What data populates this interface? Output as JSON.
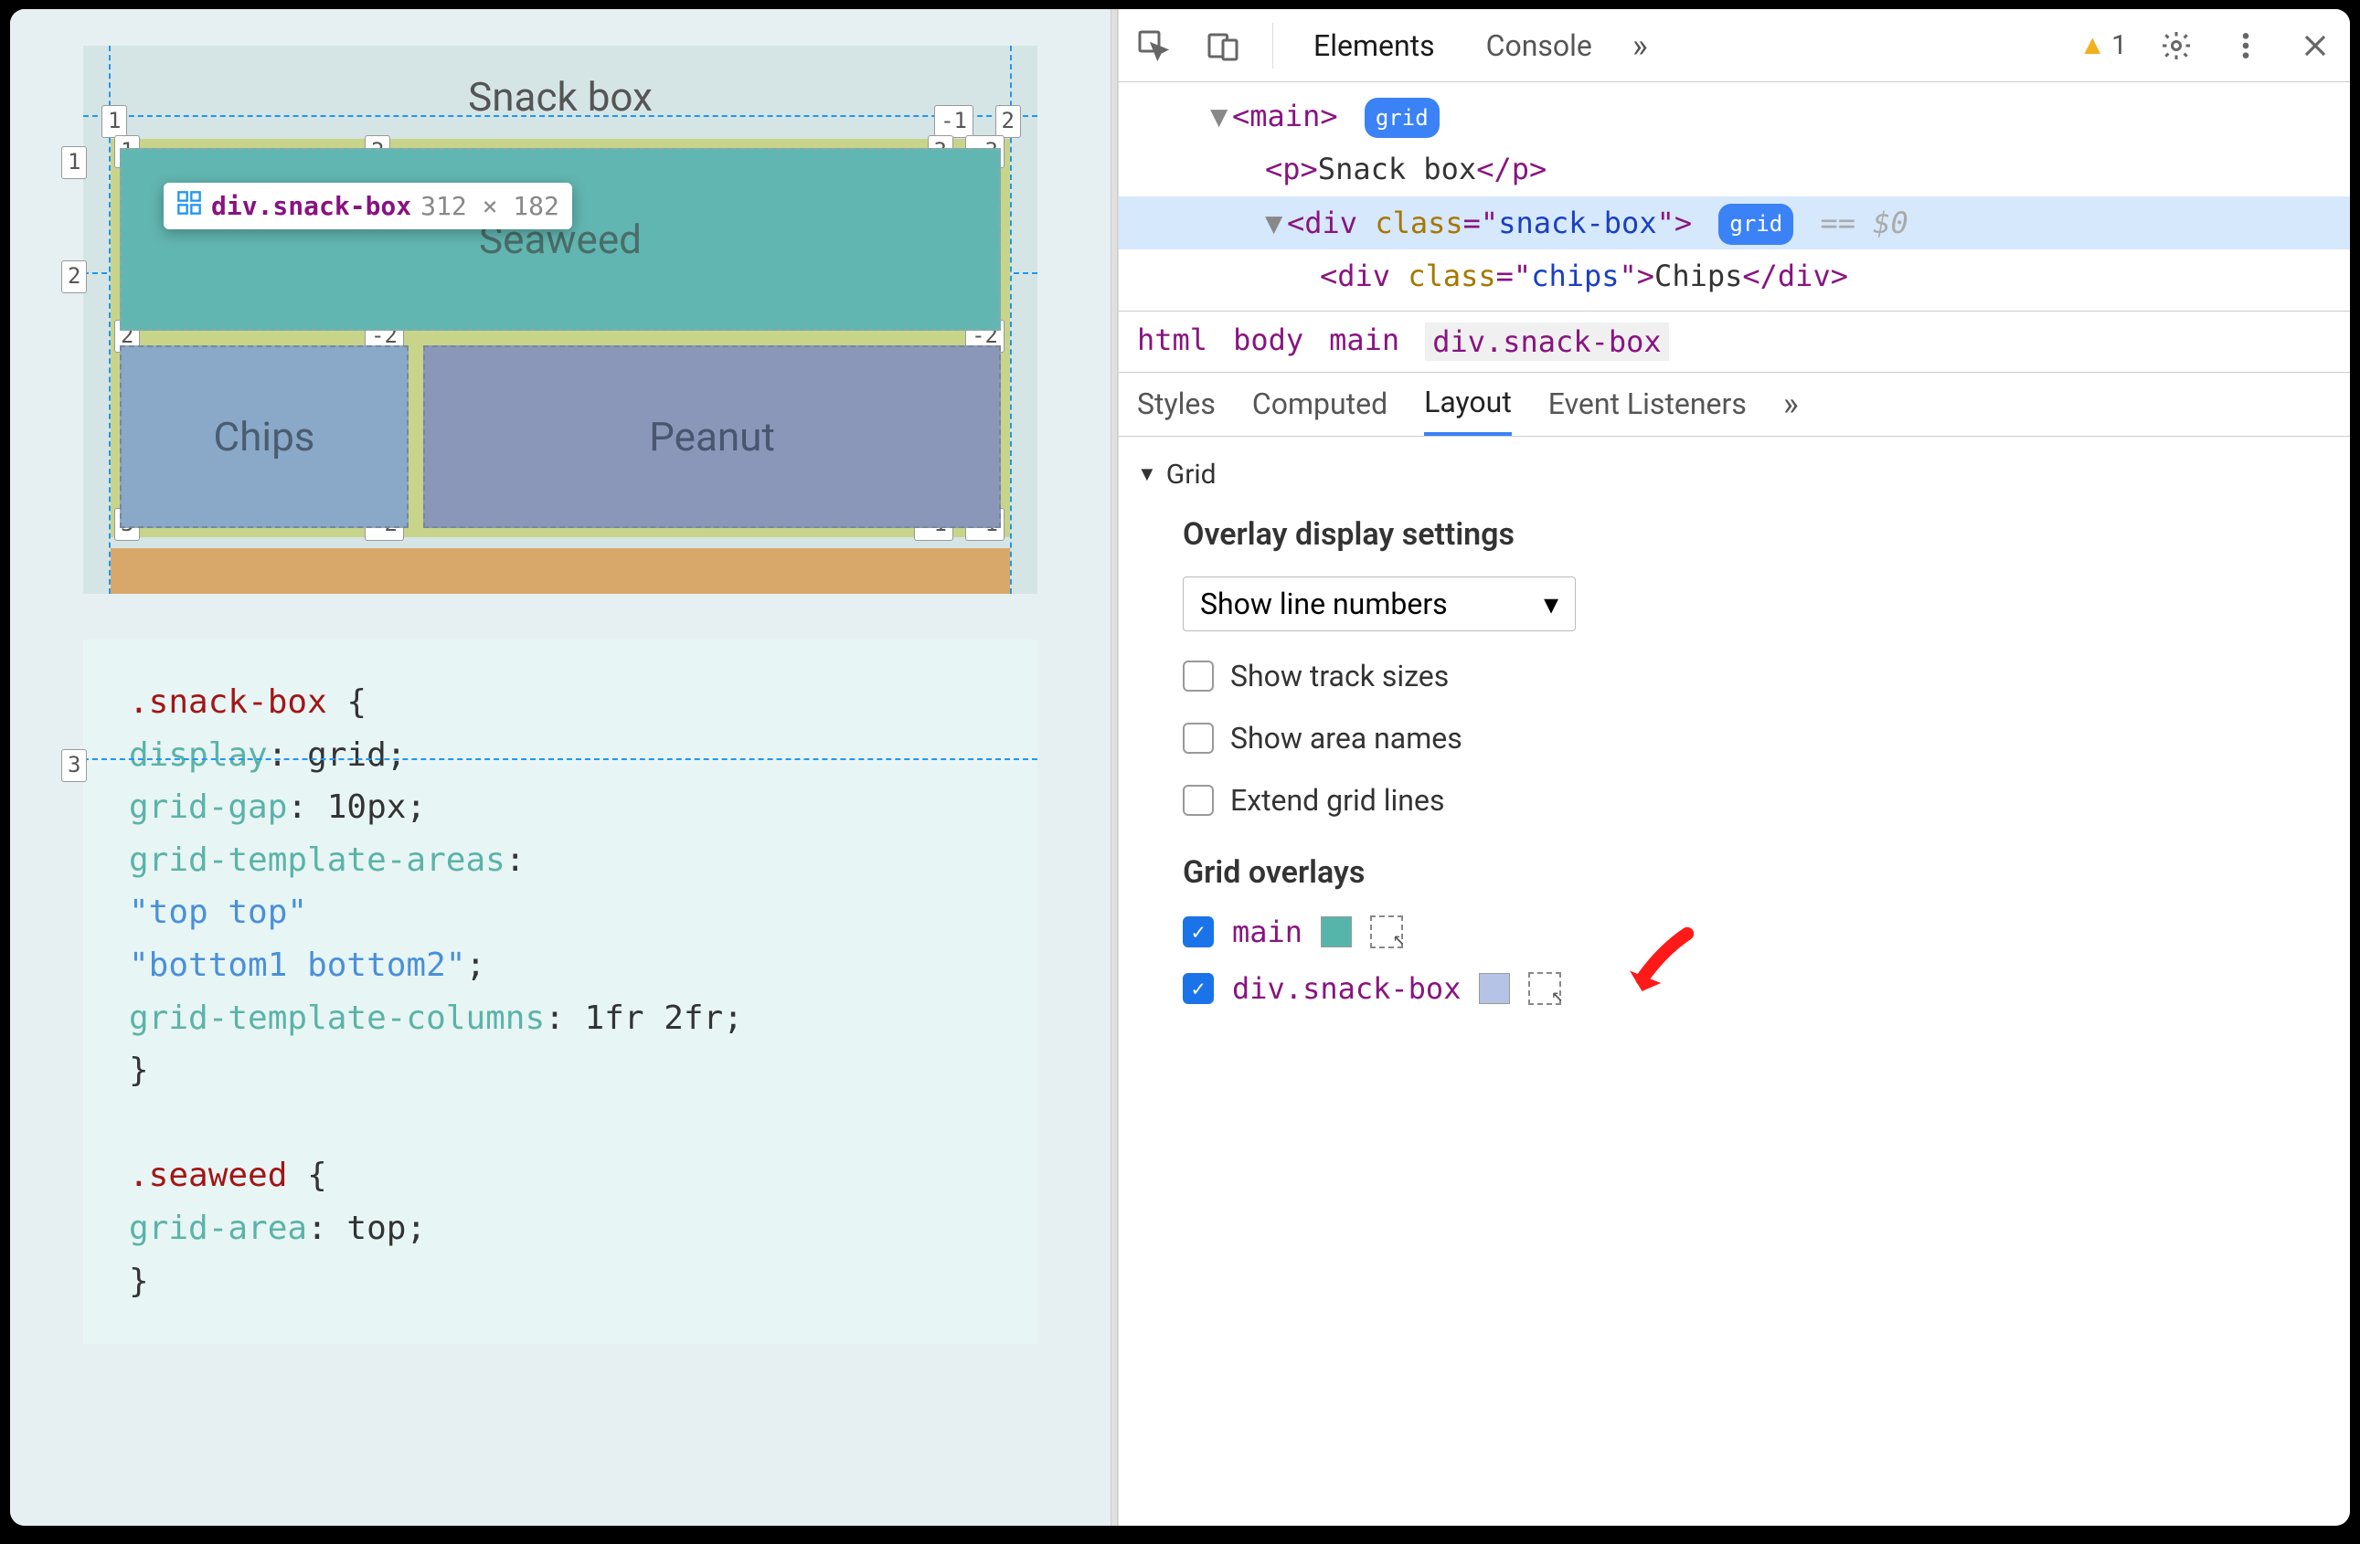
{
  "preview": {
    "heading": "Snack box",
    "cells": {
      "seaweed": "Seaweed",
      "chips": "Chips",
      "peanut": "Peanut"
    },
    "tooltip": {
      "selector": "div.snack-box",
      "dimensions": "312 × 182"
    },
    "grid_lines": {
      "outer_cols": [
        "1",
        "-1",
        "2"
      ],
      "outer_rows": [
        "1",
        "2",
        "3"
      ],
      "inner_top": [
        "1",
        "2",
        "3",
        "-3"
      ],
      "inner_mid": [
        "2",
        "-2",
        "-2"
      ],
      "inner_bot": [
        "3",
        "-2",
        "-1",
        "-1"
      ]
    }
  },
  "code": {
    "lines": [
      [
        ".snack-box",
        " {"
      ],
      [
        "  ",
        "display",
        ": grid;"
      ],
      [
        "  ",
        "grid-gap",
        ": 10px;"
      ],
      [
        "  ",
        "grid-template-areas",
        ":"
      ],
      [
        "  ",
        "",
        "\"top top\""
      ],
      [
        "  ",
        "",
        "\"bottom1 bottom2\"",
        ";"
      ],
      [
        "  ",
        "grid-template-columns",
        ": 1fr 2fr;"
      ],
      [
        "}",
        "",
        ""
      ],
      [
        "",
        "",
        ""
      ],
      [
        ".seaweed",
        " {"
      ],
      [
        "  ",
        "grid-area",
        ": top;"
      ],
      [
        "}",
        "",
        ""
      ]
    ]
  },
  "devtools": {
    "tabs": {
      "elements": "Elements",
      "console": "Console"
    },
    "warning_count": "1",
    "elements_tree": {
      "main": {
        "tag_open": "<main>",
        "badge": "grid"
      },
      "p": {
        "open": "<p>",
        "text": "Snack box",
        "close": "</p>"
      },
      "div_snack": {
        "open_prefix": "<div ",
        "attr_name": "class",
        "attr_eq": "=\"",
        "attr_val": "snack-box",
        "attr_close": "\">",
        "badge": "grid",
        "suffix": "== $0"
      },
      "div_chips": {
        "open_prefix": "<div ",
        "attr_name": "class",
        "attr_eq": "=\"",
        "attr_val": "chips",
        "attr_close": "\">",
        "text": "Chips",
        "close": "</div>"
      }
    },
    "breadcrumb": [
      "html",
      "body",
      "main",
      "div.snack-box"
    ],
    "subtabs": {
      "styles": "Styles",
      "computed": "Computed",
      "layout": "Layout",
      "events": "Event Listeners"
    },
    "layout": {
      "section": "Grid",
      "settings_heading": "Overlay display settings",
      "select": "Show line numbers",
      "checkboxes": [
        "Show track sizes",
        "Show area names",
        "Extend grid lines"
      ],
      "overlays_heading": "Grid overlays",
      "overlays": [
        {
          "label": "main",
          "color": "#56b5ab"
        },
        {
          "label": "div.snack-box",
          "color": "#b5c4e6"
        }
      ]
    }
  }
}
